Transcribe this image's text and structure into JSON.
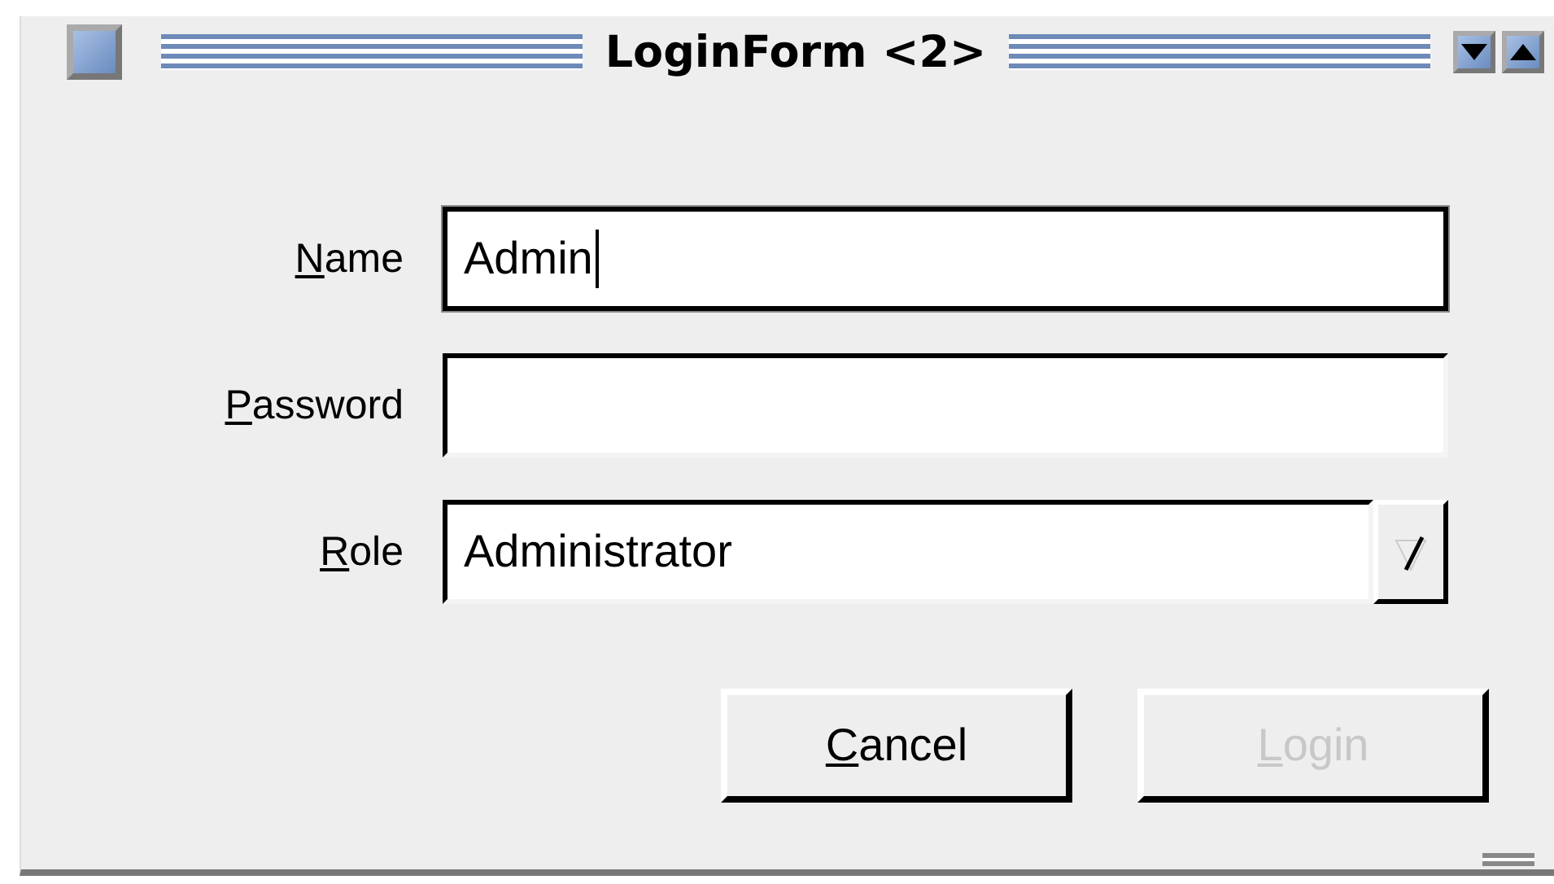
{
  "window": {
    "title": "LoginForm <2>"
  },
  "fields": [
    {
      "kind": "text",
      "label": "Name",
      "value": "Admin",
      "focused": true
    },
    {
      "kind": "password",
      "label": "Password",
      "focused": false
    },
    {
      "kind": "combo",
      "label": "Role",
      "value": "Administrator",
      "focused": false
    }
  ],
  "buttons": [
    {
      "label": "Cancel",
      "disabled": false
    },
    {
      "label": "Login",
      "disabled": true
    }
  ]
}
